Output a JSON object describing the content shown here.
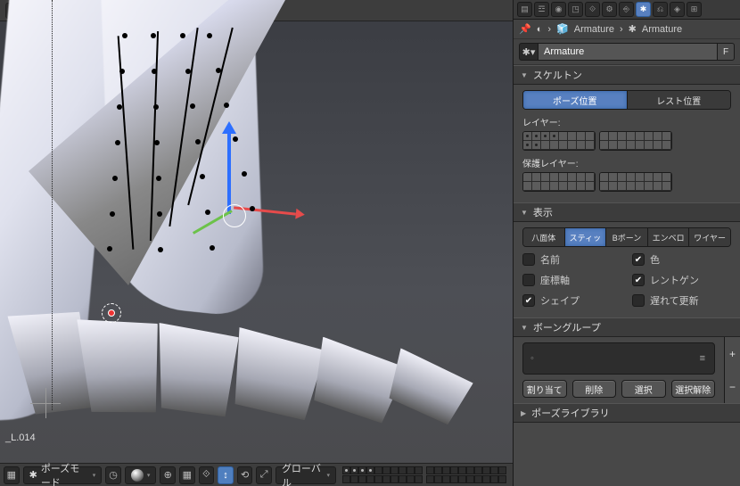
{
  "viewport": {
    "bottom_label": "_L.014",
    "mode_label": "ポーズモード",
    "orientation": "グローバル"
  },
  "sidebar": {
    "breadcrumb": {
      "item1": "Armature",
      "item2": "Armature"
    },
    "name_field": "Armature",
    "name_suffix": "F",
    "skeleton": {
      "header": "スケルトン",
      "pose_position": "ポーズ位置",
      "rest_position": "レスト位置",
      "layer_label": "レイヤー:",
      "protected_label": "保護レイヤー:"
    },
    "display": {
      "header": "表示",
      "octa": "八面体",
      "stick": "スティッ",
      "bbone": "Bボーン",
      "envelope": "エンベロ",
      "wire": "ワイヤー",
      "name_cb": "名前",
      "axes_cb": "座標軸",
      "shape_cb": "シェイプ",
      "color_cb": "色",
      "xray_cb": "レントゲン",
      "delay_cb": "遅れて更新"
    },
    "bone_groups": {
      "header": "ボーングループ",
      "assign": "割り当て",
      "remove": "削除",
      "select": "選択",
      "deselect": "選択解除"
    },
    "pose_library": {
      "header": "ポーズライブラリ"
    }
  }
}
